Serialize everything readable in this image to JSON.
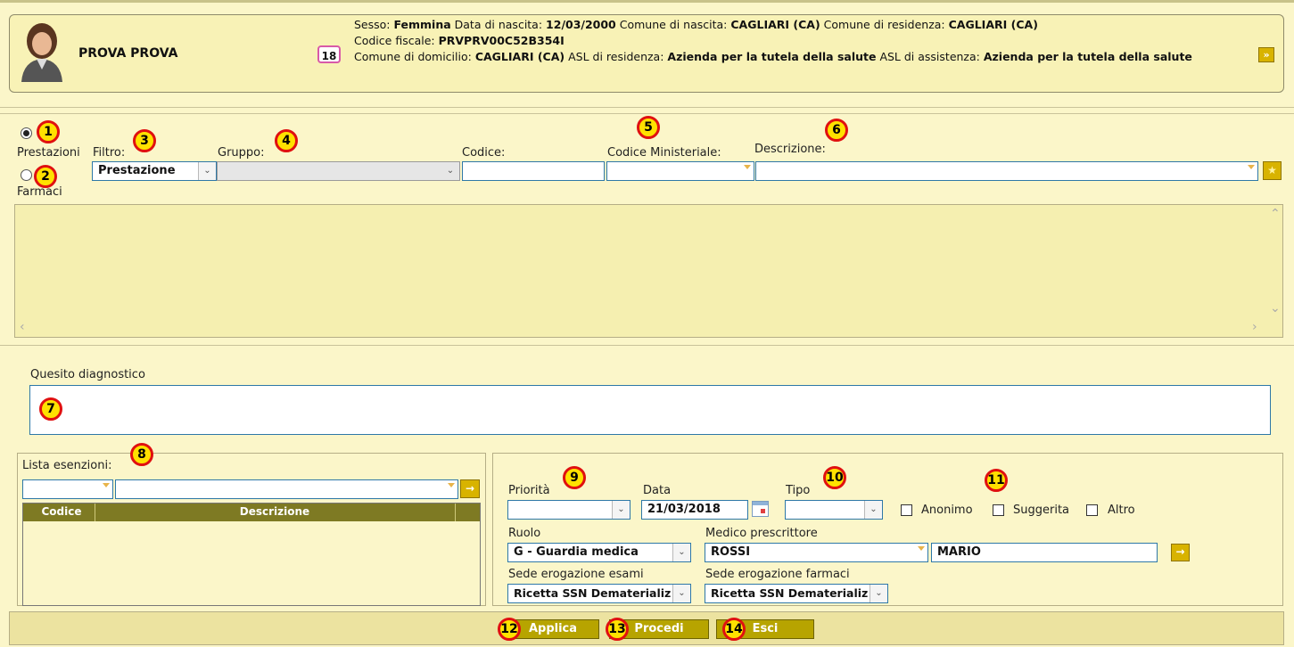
{
  "patient": {
    "name": "PROVA PROVA",
    "age": "18",
    "sesso_label": "Sesso: ",
    "sesso": "Femmina",
    "nascita_label": " Data di nascita: ",
    "nascita": "12/03/2000",
    "comune_nascita_label": " Comune di nascita: ",
    "comune_nascita": "CAGLIARI (CA)",
    "comune_residenza_label": " Comune di residenza: ",
    "comune_residenza": "CAGLIARI (CA)",
    "cf_label": "Codice fiscale: ",
    "cf": "PRVPRV00C52B354I",
    "domicilio_label": "Comune di domicilio: ",
    "domicilio": "CAGLIARI (CA)",
    "asl_res_label": " ASL di residenza: ",
    "asl_res": "Azienda per la tutela della salute",
    "asl_ass_label": " ASL di assistenza: ",
    "asl_ass": "Azienda per la tutela della salute",
    "expand_icon": "»"
  },
  "search": {
    "radio_prestazioni": "Prestazioni",
    "radio_farmaci": "Farmaci",
    "filtro_label": "Filtro:",
    "filtro_value": "Prestazione",
    "gruppo_label": "Gruppo:",
    "codice_label": "Codice:",
    "codice_min_label": "Codice Ministeriale:",
    "descrizione_label": "Descrizione:"
  },
  "quesito": {
    "label": "Quesito diagnostico"
  },
  "esenzioni": {
    "label": "Lista esenzioni:",
    "columns": [
      "Codice",
      "Descrizione"
    ]
  },
  "ricetta": {
    "priorita_label": "Priorità",
    "data_label": "Data",
    "data_value": "21/03/2018",
    "tipo_label": "Tipo",
    "anonimo": "Anonimo",
    "suggerita": "Suggerita",
    "altro": "Altro",
    "ruolo_label": "Ruolo",
    "ruolo_value": "G - Guardia medica",
    "medico_label": "Medico prescrittore",
    "medico_cognome": "ROSSI",
    "medico_nome": "MARIO",
    "sede_esami_label": "Sede erogazione esami",
    "sede_esami_value": "Ricetta SSN Dematerializ",
    "sede_farmaci_label": "Sede erogazione farmaci",
    "sede_farmaci_value": "Ricetta SSN Dematerializ"
  },
  "footer": {
    "applica": "Applica",
    "procedi": "Procedi",
    "esci": "Esci"
  },
  "badges": [
    "1",
    "2",
    "3",
    "4",
    "5",
    "6",
    "7",
    "8",
    "9",
    "10",
    "11",
    "12",
    "13",
    "14"
  ],
  "colors": {
    "accent": "#d8b300",
    "background": "#fbf6c9",
    "badge_border": "#e01010",
    "badge_fill": "#ffe100"
  }
}
